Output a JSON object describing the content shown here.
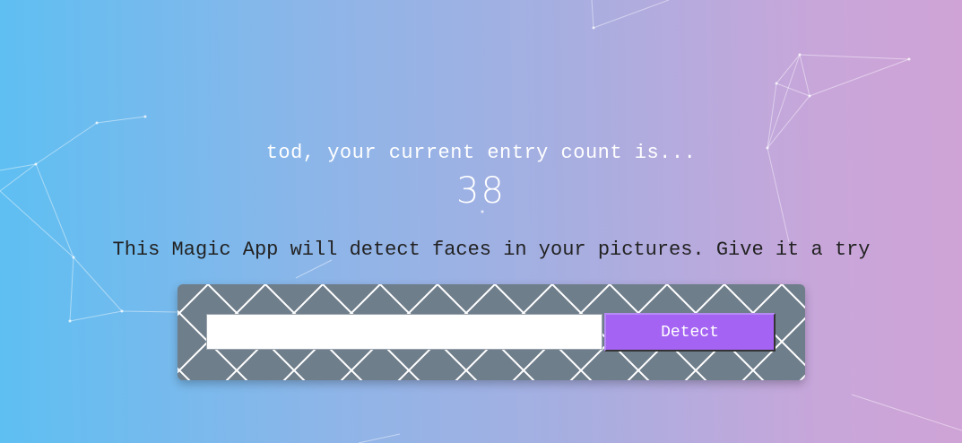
{
  "rank": {
    "greeting": "tod, your current entry count is...",
    "entry_count": "38"
  },
  "intro": {
    "text": "This Magic App will detect faces in your pictures. Give it a try"
  },
  "image_form": {
    "url_input_value": "",
    "url_input_placeholder": "",
    "detect_label": "Detect"
  },
  "colors": {
    "background_start": "#5ebff2",
    "background_end": "#cfa3d6",
    "form_background": "#6f7e8b",
    "detect_button": "#a463f2",
    "text_light": "#ffffff",
    "text_dark": "#222222"
  }
}
